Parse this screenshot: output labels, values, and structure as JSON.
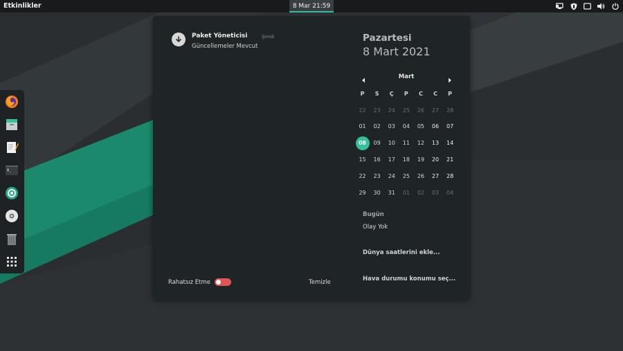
{
  "topbar": {
    "activities_label": "Etkinlikler",
    "clock_label": "8 Mar  21:59",
    "tray_icons": [
      "screen-icon",
      "shield-icon",
      "window-icon",
      "volume-icon",
      "power-icon"
    ]
  },
  "dock": {
    "items": [
      "firefox-icon",
      "files-icon",
      "text-editor-icon",
      "terminal-icon",
      "software-icon",
      "disc-icon",
      "trash-icon",
      "app-grid-icon"
    ]
  },
  "notification": {
    "title": "Paket Yöneticisi",
    "time": "Şimdi",
    "body": "Güncellemeler Mevcut"
  },
  "footer": {
    "dnd_label": "Rahatsız Etme",
    "dnd_on": false,
    "clear_label": "Temizle"
  },
  "date_header": {
    "day_name": "Pazartesi",
    "full_date": "8 Mart 2021"
  },
  "calendar": {
    "month": "Mart",
    "weekdays": [
      "P",
      "S",
      "Ç",
      "P",
      "C",
      "C",
      "P"
    ],
    "weeks": [
      [
        "22",
        "23",
        "24",
        "25",
        "26",
        "27",
        "28"
      ],
      [
        "01",
        "02",
        "03",
        "04",
        "05",
        "06",
        "07"
      ],
      [
        "08",
        "09",
        "10",
        "11",
        "12",
        "13",
        "14"
      ],
      [
        "15",
        "16",
        "17",
        "18",
        "19",
        "20",
        "21"
      ],
      [
        "22",
        "23",
        "24",
        "25",
        "26",
        "27",
        "28"
      ],
      [
        "29",
        "30",
        "31",
        "01",
        "02",
        "03",
        "04"
      ]
    ],
    "today": "08"
  },
  "events": {
    "today_label": "Bugün",
    "no_events": "Olay Yok"
  },
  "world_clocks_label": "Dünya saatlerini ekle...",
  "weather_label": "Hava durumu konumu seç...",
  "colors": {
    "accent": "#35bf9c",
    "panel": "#1f2426",
    "toggle_off": "#e05454"
  }
}
